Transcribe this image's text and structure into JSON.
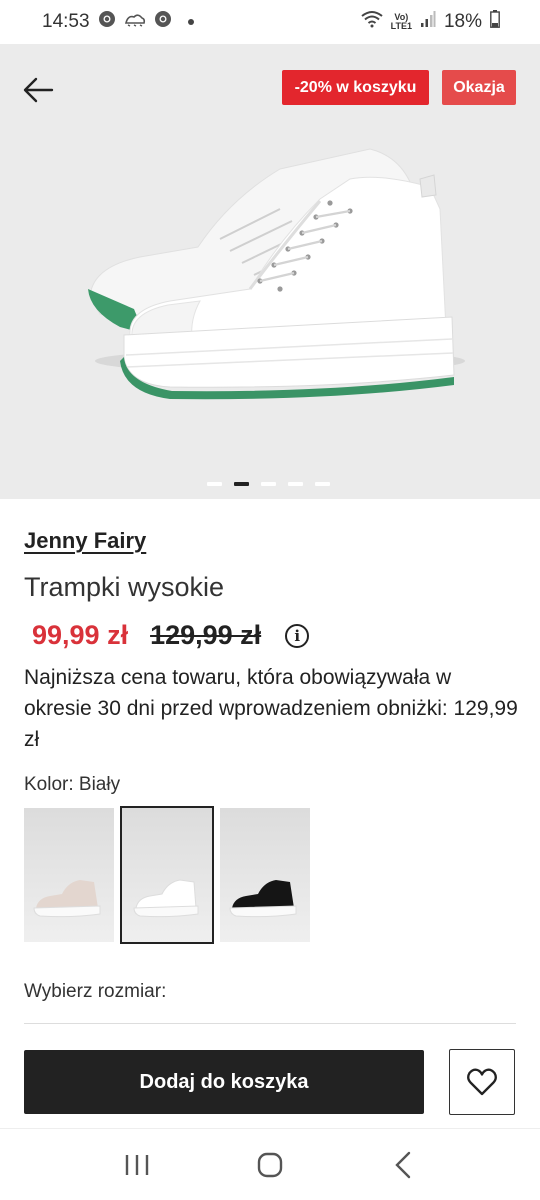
{
  "status_bar": {
    "time": "14:53",
    "battery": "18%",
    "icons": [
      "chrome-icon",
      "weather-icon",
      "chrome-icon",
      "wifi-icon",
      "volte-icon",
      "signal-icon",
      "battery-icon"
    ],
    "volte_line1": "Vo)",
    "volte_line2": "LTE1"
  },
  "hero": {
    "badge_discount": "-20% w koszyku",
    "badge_okazja": "Okazja",
    "pages": 5,
    "active_page": 1
  },
  "product": {
    "brand": "Jenny Fairy",
    "title": "Trampki wysokie",
    "price_new": "99,99 zł",
    "price_old": "129,99 zł",
    "lowest_price_note": "Najniższa cena towaru, która obowiązywała w okresie 30 dni przed wprowadzeniem obniżki: 129,99 zł",
    "color_label": "Kolor: Biały",
    "size_label": "Wybierz rozmiar:",
    "add_to_cart": "Dodaj do koszyka"
  },
  "swatches": [
    {
      "name": "beige",
      "color": "#e3d6cf",
      "selected": false
    },
    {
      "name": "white",
      "color": "#ffffff",
      "selected": true
    },
    {
      "name": "black",
      "color": "#151515",
      "selected": false
    }
  ],
  "colors": {
    "accent_red": "#e3262d",
    "price_red": "#d9323a",
    "dark": "#222222",
    "hero_bg": "#ebebeb"
  }
}
